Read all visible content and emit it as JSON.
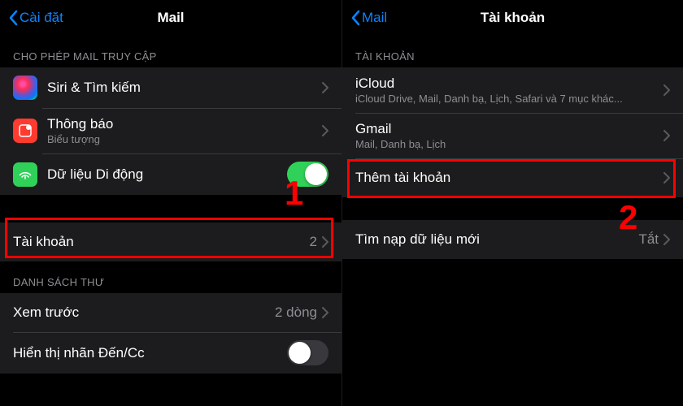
{
  "left": {
    "back_label": "Cài đặt",
    "title": "Mail",
    "section_access": "CHO PHÉP MAIL TRUY CẬP",
    "siri_label": "Siri & Tìm kiếm",
    "notifications_label": "Thông báo",
    "notifications_sub": "Biểu tượng",
    "cellular_label": "Dữ liệu Di động",
    "accounts_label": "Tài khoản",
    "accounts_count": "2",
    "section_list": "DANH SÁCH THƯ",
    "preview_label": "Xem trước",
    "preview_value": "2 dòng",
    "tocc_label": "Hiển thị nhãn Đến/Cc",
    "callout": "1"
  },
  "right": {
    "back_label": "Mail",
    "title": "Tài khoản",
    "section_accounts": "TÀI KHOẢN",
    "icloud_label": "iCloud",
    "icloud_sub": "iCloud Drive, Mail, Danh bạ, Lịch, Safari và 7 mục khác...",
    "gmail_label": "Gmail",
    "gmail_sub": "Mail, Danh bạ, Lịch",
    "add_label": "Thêm tài khoản",
    "fetch_label": "Tìm nạp dữ liệu mới",
    "fetch_value": "Tắt",
    "callout": "2"
  }
}
